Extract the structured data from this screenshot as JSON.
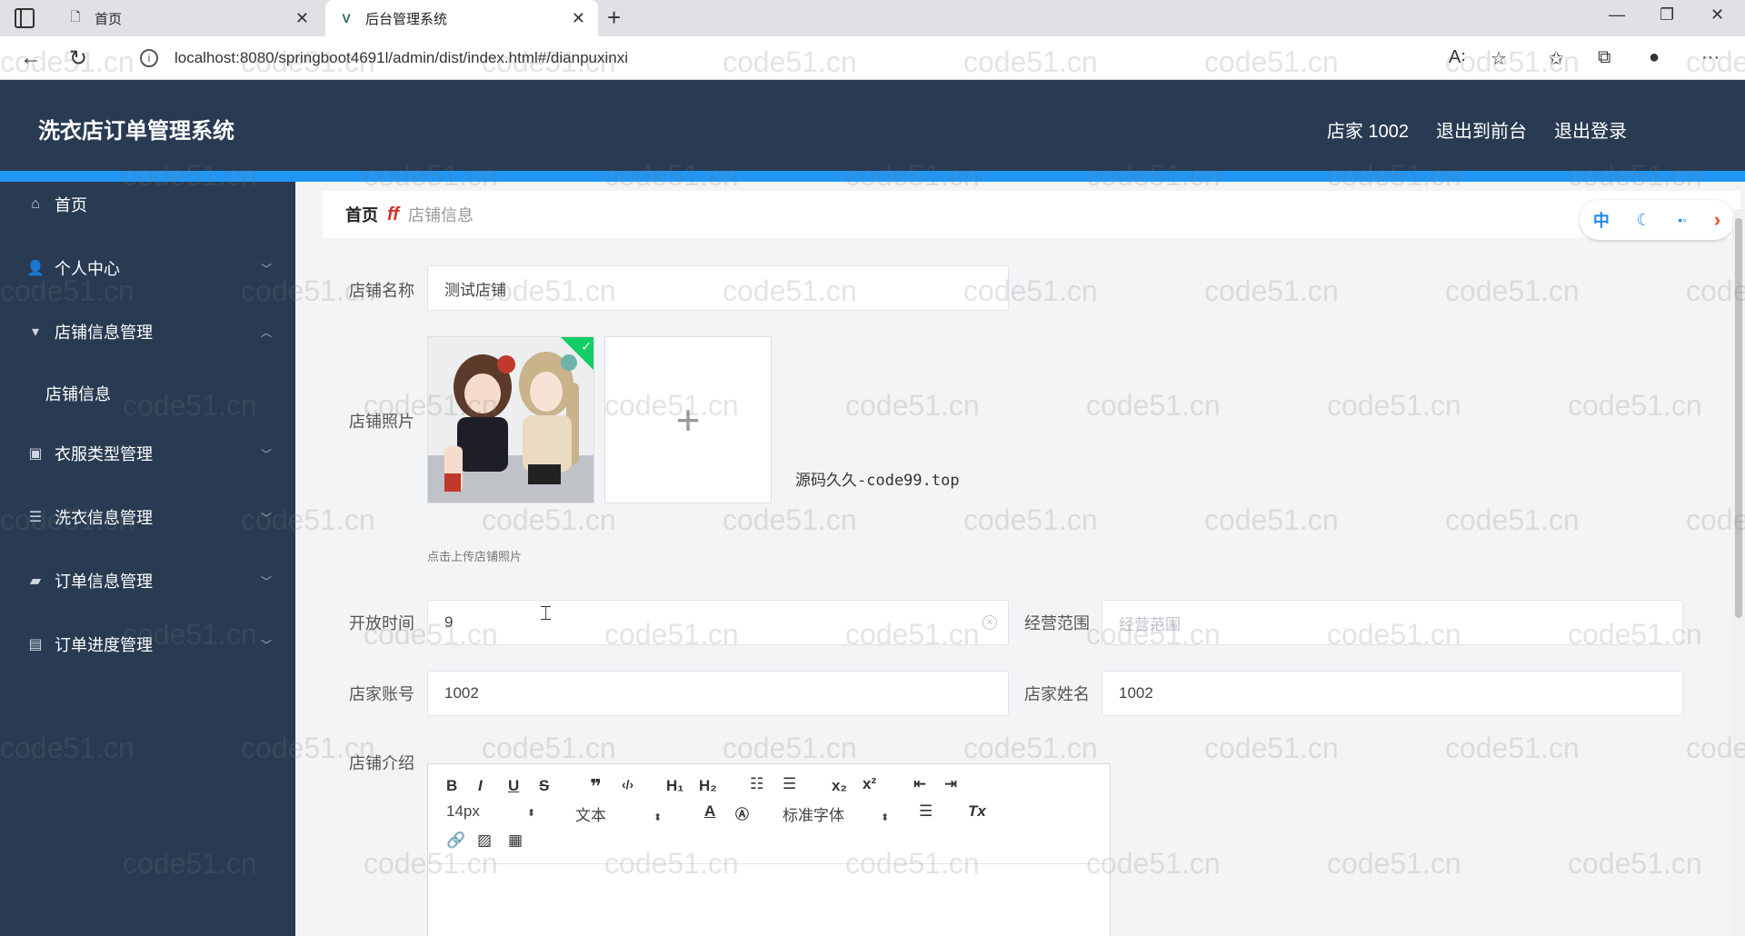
{
  "browser": {
    "tabs": [
      {
        "label": "首页",
        "icon": "document-icon"
      },
      {
        "label": "后台管理系统",
        "icon": "vue-logo-icon"
      }
    ],
    "url": "localhost:8080/springboot4691l/admin/dist/index.html#/dianpuxinxi"
  },
  "header": {
    "title": "洗衣店订单管理系统",
    "user": "店家 1002",
    "to_front": "退出到前台",
    "logout": "退出登录"
  },
  "sidebar": {
    "items": [
      {
        "label": "首页",
        "icon": "home-icon"
      },
      {
        "label": "个人中心",
        "icon": "user-icon"
      },
      {
        "label": "店铺信息管理",
        "icon": "shop-icon"
      },
      {
        "label": "衣服类型管理",
        "icon": "clipboard-icon"
      },
      {
        "label": "洗衣信息管理",
        "icon": "list-icon"
      },
      {
        "label": "订单信息管理",
        "icon": "order-icon"
      },
      {
        "label": "订单进度管理",
        "icon": "briefcase-icon"
      }
    ],
    "sub_item": "店铺信息"
  },
  "breadcrumb": {
    "home": "首页",
    "separator": "ff",
    "current": "店铺信息"
  },
  "tools": {
    "lang": "中"
  },
  "form": {
    "shop_name_label": "店铺名称",
    "shop_name_value": "测试店铺",
    "shop_photo_label": "店铺照片",
    "upload_tip": "点击上传店铺照片",
    "watermark_text": "源码久久-code99.top",
    "open_time_label": "开放时间",
    "open_time_value": "9",
    "scope_label": "经营范围",
    "scope_placeholder": "经营范围",
    "account_label": "店家账号",
    "account_value": "1002",
    "owner_name_label": "店家姓名",
    "owner_name_value": "1002",
    "intro_label": "店铺介绍"
  },
  "editor": {
    "font_size": "14px",
    "text_type": "文本",
    "font_family": "标准字体"
  },
  "watermark": "code51.cn"
}
